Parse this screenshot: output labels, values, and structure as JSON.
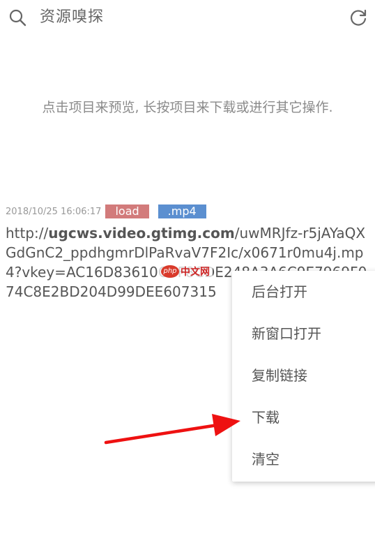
{
  "header": {
    "title": "资源嗅探",
    "search_icon": "search-icon",
    "refresh_icon": "refresh-icon"
  },
  "hint": "点击项目来预览, 长按项目来下载或进行其它操作.",
  "item": {
    "timestamp": "2018/10/25 16:06:17",
    "tag_status": "load",
    "tag_ext": ".mp4",
    "url_prefix": "http://",
    "url_host": "ugcws.video.gtimg.com",
    "url_rest": "/uwMRJfz-r5jAYaQXGdGnC2_ppdhgmrDlPaRvaV7F2Ic/x0671r0mu4j.mp4?vkey=AC16D83610CCF8CDE248A3A6C9E7969F074C8E2BD204D99DEE607315"
  },
  "watermark": {
    "badge": "php",
    "text": "中文网"
  },
  "context_menu": {
    "items": [
      {
        "label": "后台打开"
      },
      {
        "label": "新窗口打开"
      },
      {
        "label": "复制链接"
      },
      {
        "label": "下载"
      },
      {
        "label": "清空"
      }
    ]
  },
  "colors": {
    "tag_load_bg": "#d27b7b",
    "tag_ext_bg": "#5b8fd0",
    "arrow": "#ee1111"
  }
}
